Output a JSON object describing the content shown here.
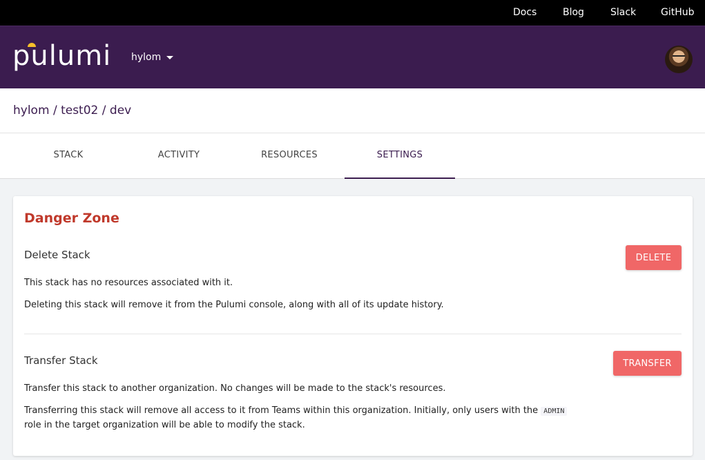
{
  "topnav": {
    "links": [
      "Docs",
      "Blog",
      "Slack",
      "GitHub"
    ]
  },
  "header": {
    "logo_text": "pulumi",
    "org_name": "hylom",
    "accent_color": "#3b1c4f",
    "logo_accent_color": "#f7bf2a"
  },
  "breadcrumb": {
    "org": "hylom",
    "project": "test02",
    "stack": "dev",
    "separator": "/"
  },
  "tabs": {
    "items": [
      "STACK",
      "ACTIVITY",
      "RESOURCES",
      "SETTINGS"
    ],
    "active": "SETTINGS"
  },
  "danger_zone": {
    "title": "Danger Zone",
    "title_color": "#c0392b",
    "button_color": "#f06767",
    "delete": {
      "title": "Delete Stack",
      "button_label": "DELETE",
      "line1": "This stack has no resources associated with it.",
      "line2": "Deleting this stack will remove it from the Pulumi console, along with all of its update history."
    },
    "transfer": {
      "title": "Transfer Stack",
      "button_label": "TRANSFER",
      "line1": "Transfer this stack to another organization. No changes will be made to the stack's resources.",
      "line2_before": "Transferring this stack will remove all access to it from Teams within this organization. Initially, only users with the",
      "line2_code": "ADMIN",
      "line2_after": "role in the target organization will be able to modify the stack."
    }
  }
}
